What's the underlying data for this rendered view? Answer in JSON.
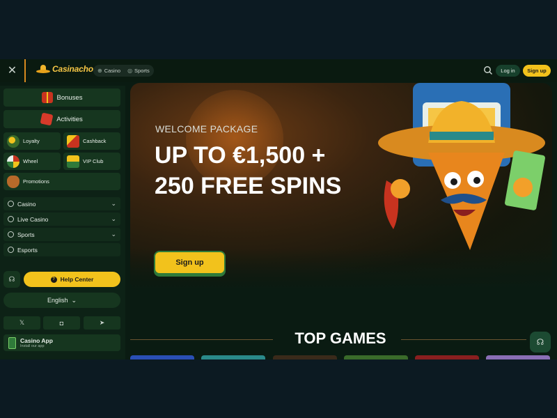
{
  "header": {
    "logo_text": "Casinacho",
    "nav": [
      {
        "label": "Casino",
        "icon": "casino-chip-icon"
      },
      {
        "label": "Sports",
        "icon": "sports-ball-icon"
      }
    ],
    "login_label": "Log in",
    "signup_label": "Sign up"
  },
  "sidebar": {
    "bonuses_label": "Bonuses",
    "activities_label": "Activities",
    "tiles": [
      {
        "label": "Loyalty",
        "icon": "loyalty-icon"
      },
      {
        "label": "Cashback",
        "icon": "cashback-icon"
      },
      {
        "label": "Wheel",
        "icon": "wheel-icon"
      },
      {
        "label": "VIP Club",
        "icon": "vip-club-icon"
      },
      {
        "label": "Promotions",
        "icon": "promotions-icon"
      }
    ],
    "menu": [
      {
        "label": "Casino",
        "has_chevron": true
      },
      {
        "label": "Live Casino",
        "has_chevron": true
      },
      {
        "label": "Sports",
        "has_chevron": true
      },
      {
        "label": "Esports",
        "has_chevron": false
      }
    ],
    "help_label": "Help Center",
    "language_label": "English",
    "socials": [
      "x-icon",
      "instagram-icon",
      "telegram-icon"
    ],
    "app_title": "Casino App",
    "app_subtitle": "Install our app"
  },
  "banner": {
    "welcome": "WELCOME PACKAGE",
    "headline": "UP TO €1,500 + 250 FREE SPINS",
    "signup_label": "Sign up"
  },
  "top_games": {
    "title": "TOP GAMES"
  },
  "colors": {
    "accent": "#f2c21c",
    "sidebar_bg": "#0d2216",
    "tile_bg": "#16361f"
  }
}
